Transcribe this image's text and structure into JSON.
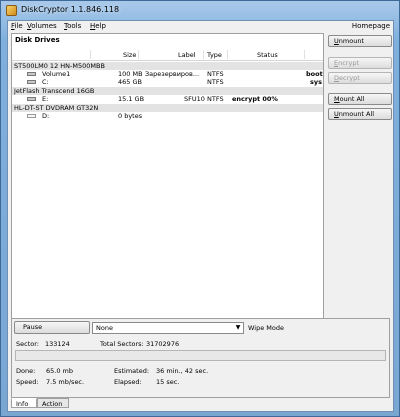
{
  "window": {
    "title": "DiskCryptor 1.1.846.118"
  },
  "menu": {
    "items": [
      {
        "key": "F",
        "rest": "ile"
      },
      {
        "key": "V",
        "rest": "olumes"
      },
      {
        "key": "T",
        "rest": "ools"
      },
      {
        "key": "H",
        "rest": "elp"
      }
    ],
    "homepage": "Homepage"
  },
  "panel": {
    "title": "Disk Drives"
  },
  "columns": {
    "size": "Size",
    "label": "Label",
    "type": "Type",
    "status": "Status"
  },
  "disks": [
    {
      "name": "ST500LM0 12 HN-M500MBB"
    },
    {
      "name": "JetFlash Transcend 16GB"
    },
    {
      "name": "HL-DT-ST DVDRAM GT32N"
    }
  ],
  "volumes": [
    {
      "name": "Volume1",
      "size": "100 MB",
      "label": "Зарезервиров...",
      "type": "NTFS",
      "status": "",
      "extra": "boot"
    },
    {
      "name": "C:",
      "size": "465 GB",
      "label": "",
      "type": "NTFS",
      "status": "",
      "extra": "sys"
    },
    {
      "name": "E:",
      "size": "15.1 GB",
      "label": "SFU10",
      "type": "NTFS",
      "status": "encrypt 00%",
      "extra": ""
    },
    {
      "name": "D:",
      "size": "0 bytes",
      "label": "",
      "type": "",
      "status": "",
      "extra": ""
    }
  ],
  "buttons": {
    "unmount": {
      "key": "U",
      "rest": "nmount"
    },
    "encrypt": {
      "key": "E",
      "rest": "ncrypt"
    },
    "decrypt": {
      "key": "D",
      "rest": "ecrypt"
    },
    "mount_all": {
      "key": "M",
      "rest": "ount All"
    },
    "unmount_all": {
      "key": "U",
      "rest": "nmount All"
    }
  },
  "action": {
    "pause": "Pause",
    "wipe_mode_value": "None",
    "wipe_mode_label": "Wipe Mode",
    "sector_label": "Sector:",
    "sector_value": "133124",
    "total_sectors_label": "Total Sectors:",
    "total_sectors_value": "31702976",
    "progress": 0.0,
    "done_label": "Done:",
    "done_value": "65.0 mb",
    "speed_label": "Speed:",
    "speed_value": "7.5 mb/sec.",
    "estimated_label": "Estimated:",
    "estimated_value": "36 min., 42 sec.",
    "elapsed_label": "Elapsed:",
    "elapsed_value": "15 sec."
  },
  "tabs": {
    "info": "Info",
    "action": "Action"
  }
}
